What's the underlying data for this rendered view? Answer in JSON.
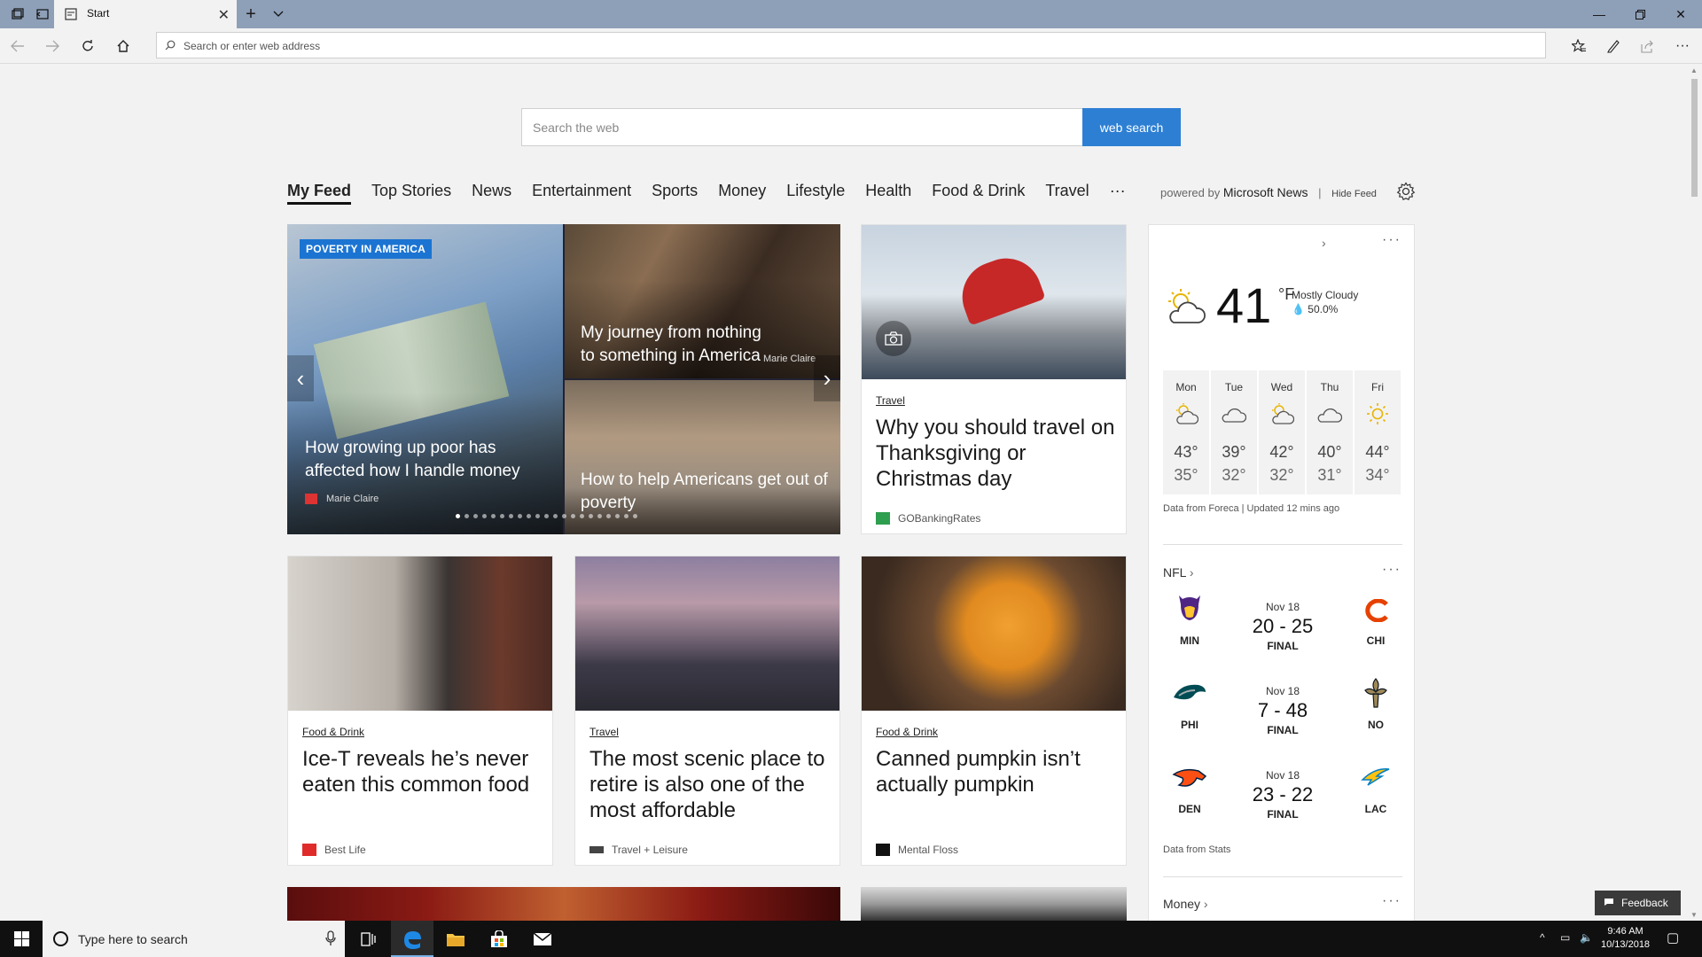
{
  "browser": {
    "tab_title": "Start",
    "address_placeholder": "Search or enter web address"
  },
  "search": {
    "placeholder": "Search the web",
    "button_label": "web search"
  },
  "feed_tabs": [
    "My Feed",
    "Top Stories",
    "News",
    "Entertainment",
    "Sports",
    "Money",
    "Lifestyle",
    "Health",
    "Food & Drink",
    "Travel",
    "···"
  ],
  "powered": {
    "prefix": "powered by",
    "brand": "Microsoft News",
    "hide_feed": "Hide Feed"
  },
  "hero": {
    "tag": "POVERTY IN AMERICA",
    "main_title": "How growing up poor has affected how I handle money",
    "main_source": "Marie Claire",
    "top_right_title": "My journey from nothing to something in America",
    "top_right_source": "Marie Claire",
    "bottom_right_title": "How to help Americans get out of poverty",
    "slide_count": 21,
    "active_slide": 1
  },
  "cards": [
    {
      "category": "Travel",
      "title": "Why you should travel on Thanksgiving or Christmas day",
      "source": "GOBankingRates",
      "logo_color": "#2e9e4f"
    },
    {
      "category": "Food & Drink",
      "title": "Ice-T reveals he’s never eaten this common food",
      "source": "Best Life",
      "logo_color": "#e02b2b"
    },
    {
      "category": "Travel",
      "title": "The most scenic place to retire is also one of the most affordable",
      "source": "Travel + Leisure",
      "logo_color": "#444444"
    },
    {
      "category": "Food & Drink",
      "title": "Canned pumpkin isn’t actually pumpkin",
      "source": "Mental Floss",
      "logo_color": "#111111"
    }
  ],
  "weather": {
    "temp": "41",
    "unit": "°F",
    "condition": "Mostly Cloudy",
    "precip": "50.0%",
    "footer": "Data from Foreca | Updated 12 mins ago",
    "days": [
      {
        "name": "Mon",
        "hi": "43°",
        "lo": "35°",
        "icon": "partly-sunny-icon"
      },
      {
        "name": "Tue",
        "hi": "39°",
        "lo": "32°",
        "icon": "cloud-icon"
      },
      {
        "name": "Wed",
        "hi": "42°",
        "lo": "32°",
        "icon": "partly-sunny-icon"
      },
      {
        "name": "Thu",
        "hi": "40°",
        "lo": "31°",
        "icon": "cloud-icon"
      },
      {
        "name": "Fri",
        "hi": "44°",
        "lo": "34°",
        "icon": "sun-icon"
      }
    ]
  },
  "nfl": {
    "title": "NFL",
    "footer": "Data from Stats",
    "games": [
      {
        "date": "Nov 18",
        "score": "20 - 25",
        "status": "FINAL",
        "home": "MIN",
        "away": "CHI"
      },
      {
        "date": "Nov 18",
        "score": "7 - 48",
        "status": "FINAL",
        "home": "PHI",
        "away": "NO"
      },
      {
        "date": "Nov 18",
        "score": "23 - 22",
        "status": "FINAL",
        "home": "DEN",
        "away": "LAC"
      }
    ]
  },
  "money": {
    "title": "Money"
  },
  "feedback_label": "Feedback",
  "taskbar": {
    "search_placeholder": "Type here to search",
    "time": "9:46 AM",
    "date": "10/13/2018"
  },
  "colors": {
    "accent": "#2d7fd3",
    "titlebar": "#8e9fb8",
    "tag": "#1b74d2"
  }
}
